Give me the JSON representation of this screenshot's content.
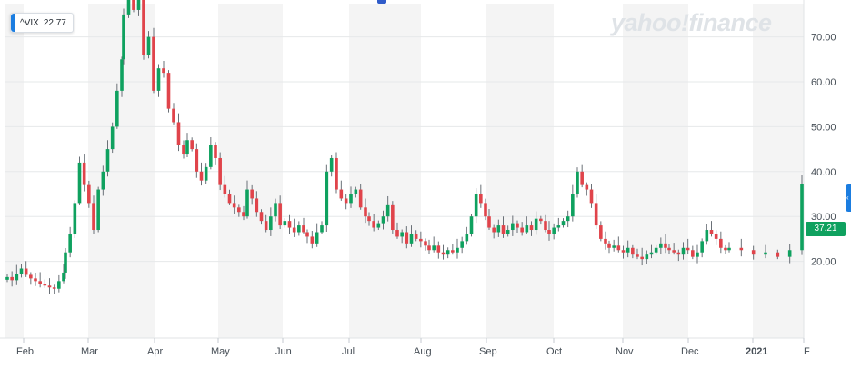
{
  "ticker": {
    "symbol": "^VIX",
    "value": "22.77"
  },
  "watermark": "yahoo!finance",
  "last_price": "37.21",
  "colors": {
    "up": "#0fa15f",
    "down": "#e0444b",
    "band": "#f4f4f4",
    "accent": "#1b7de0"
  },
  "icons": {
    "right_handle": "chevron-left-icon"
  },
  "chart_data": {
    "type": "candlestick",
    "title": "",
    "xlabel": "",
    "ylabel": "",
    "ylim": [
      10,
      87
    ],
    "yticks": [
      "20.00",
      "30.00",
      "40.00",
      "50.00",
      "60.00",
      "70.00",
      "80.00"
    ],
    "xticks": [
      "Feb",
      "Mar",
      "Apr",
      "May",
      "Jun",
      "Jul",
      "Aug",
      "Sep",
      "Oct",
      "Nov",
      "Dec",
      "2021",
      "F"
    ],
    "grid": true,
    "series": [
      {
        "close": [
          {
            "m": "Jan",
            "v": [
              16.5,
              15.8,
              17.2,
              18.4,
              17.0,
              16.2,
              15.6,
              15.0,
              14.6,
              14.2,
              13.9,
              15.6,
              17.5
            ]
          },
          {
            "m": "Feb",
            "v": [
              22.0,
              26.0,
              33.0,
              42.0,
              37.0,
              33.0,
              27.0,
              36.0,
              40.0,
              45.0,
              50.0,
              58.0,
              65.0
            ]
          },
          {
            "m": "Mar",
            "v": [
              75.0,
              82.0,
              76.0,
              85.0,
              66.0,
              70.0,
              58.0,
              63.0,
              62.0,
              54.0,
              51.0,
              46.0,
              44.0
            ]
          },
          {
            "m": "Apr",
            "v": [
              47.0,
              45.0,
              40.0,
              38.0,
              41.0,
              46.0,
              43.0,
              37.0,
              35.0,
              33.0,
              32.0,
              31.0,
              30.0
            ]
          },
          {
            "m": "May",
            "v": [
              36.0,
              34.0,
              31.0,
              29.0,
              27.0,
              30.0,
              33.0,
              28.0,
              29.0,
              27.5,
              26.5,
              28.0,
              26.5
            ]
          },
          {
            "m": "Jun",
            "v": [
              25.5,
              24.0,
              26.5,
              28.0,
              40.0,
              43.0,
              36.0,
              34.0,
              33.0,
              35.0,
              36.0,
              32.0,
              30.0
            ]
          },
          {
            "m": "Jul",
            "v": [
              29.0,
              27.5,
              28.5,
              30.0,
              32.5,
              27.0,
              25.5,
              26.5,
              24.0,
              26.0,
              25.0,
              24.5,
              23.5
            ]
          },
          {
            "m": "Aug",
            "v": [
              22.5,
              23.5,
              22.0,
              21.5,
              22.5,
              22.0,
              23.0,
              24.5,
              26.0,
              30.0,
              35.0,
              33.0,
              30.0
            ]
          },
          {
            "m": "Sep",
            "v": [
              27.5,
              26.5,
              28.0,
              26.0,
              27.0,
              28.5,
              27.5,
              26.5,
              28.0,
              27.0,
              29.5,
              29.0,
              27.0
            ]
          },
          {
            "m": "Oct",
            "v": [
              26.0,
              27.5,
              28.0,
              29.0,
              30.0,
              35.0,
              40.0,
              37.0,
              36.0,
              33.0,
              28.0,
              25.0,
              24.0
            ]
          },
          {
            "m": "Nov",
            "v": [
              23.0,
              23.5,
              22.5,
              22.0,
              23.0,
              21.5,
              21.0,
              20.5,
              21.5,
              22.0,
              23.0,
              24.0,
              23.0
            ]
          },
          {
            "m": "Dec",
            "v": [
              22.5,
              22.0,
              21.5,
              23.0,
              22.5,
              21.0,
              22.0,
              24.5,
              27.0,
              26.0,
              25.0,
              23.0,
              22.5
            ]
          },
          {
            "m": "Jan2",
            "v": [
              23.0,
              22.5,
              21.5,
              22.0,
              21.0,
              22.5,
              37.21
            ]
          }
        ]
      }
    ]
  }
}
